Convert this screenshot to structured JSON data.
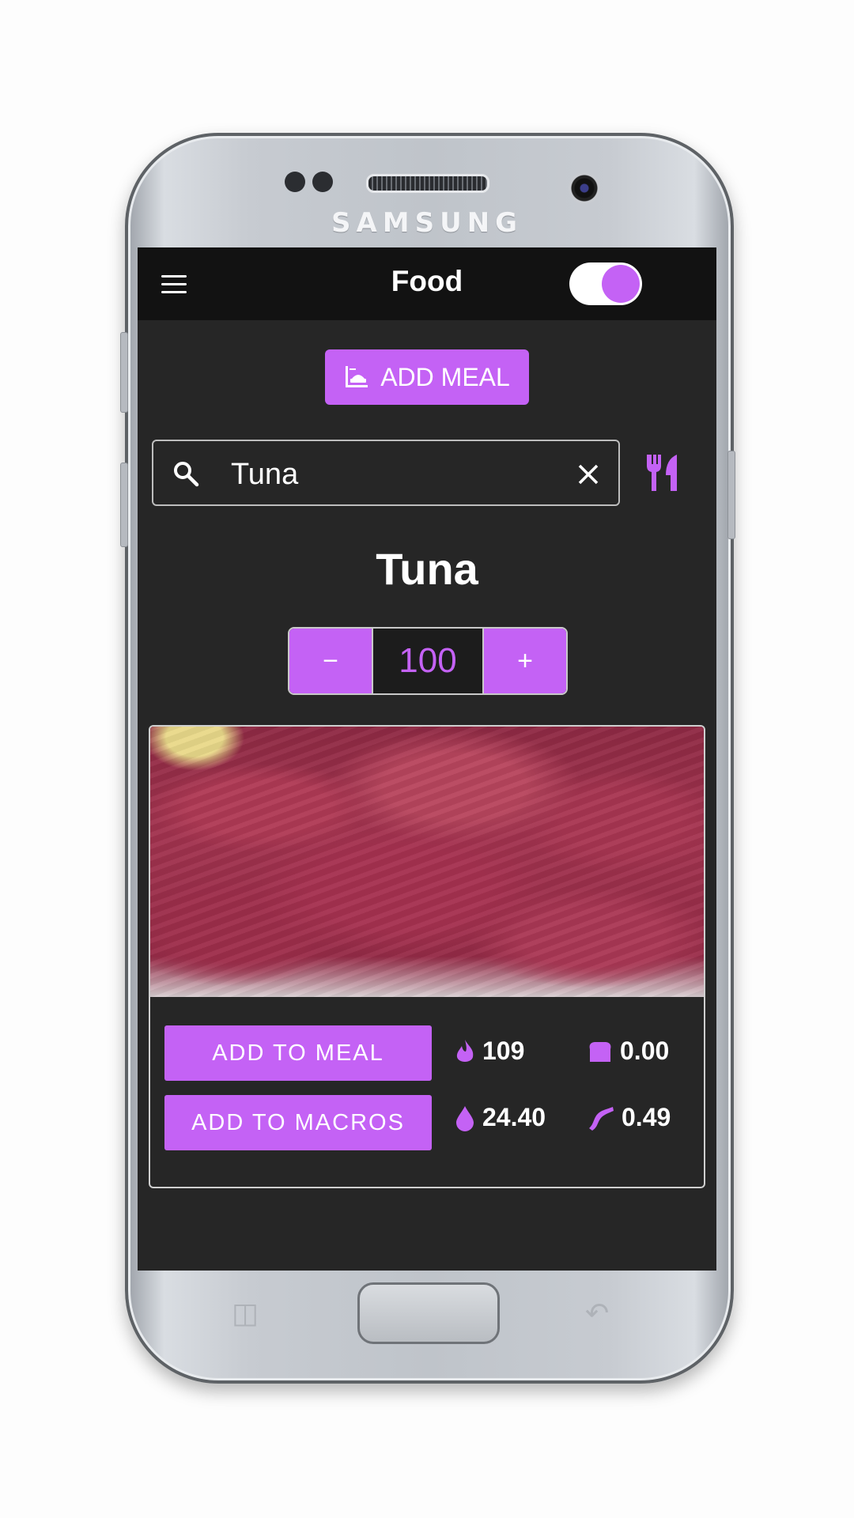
{
  "device": {
    "brand": "SAMSUNG"
  },
  "appbar": {
    "title": "Food",
    "dark_mode_on": true
  },
  "add_meal_button": {
    "label": "ADD MEAL",
    "icon": "meal-scale-icon"
  },
  "search": {
    "value": "Tuna",
    "placeholder": ""
  },
  "food": {
    "name": "Tuna",
    "quantity": "100",
    "stepper_minus": "−",
    "stepper_plus": "+",
    "image_description": "raw tuna",
    "actions": {
      "add_to_meal": "ADD TO MEAL",
      "add_to_macros": "ADD TO MACROS"
    },
    "nutrients": {
      "calories": "109",
      "carbs": "0.00",
      "protein": "24.40",
      "fat": "0.49"
    }
  },
  "colors": {
    "accent": "#c462f5",
    "background": "#262626",
    "appbar": "#121212"
  }
}
